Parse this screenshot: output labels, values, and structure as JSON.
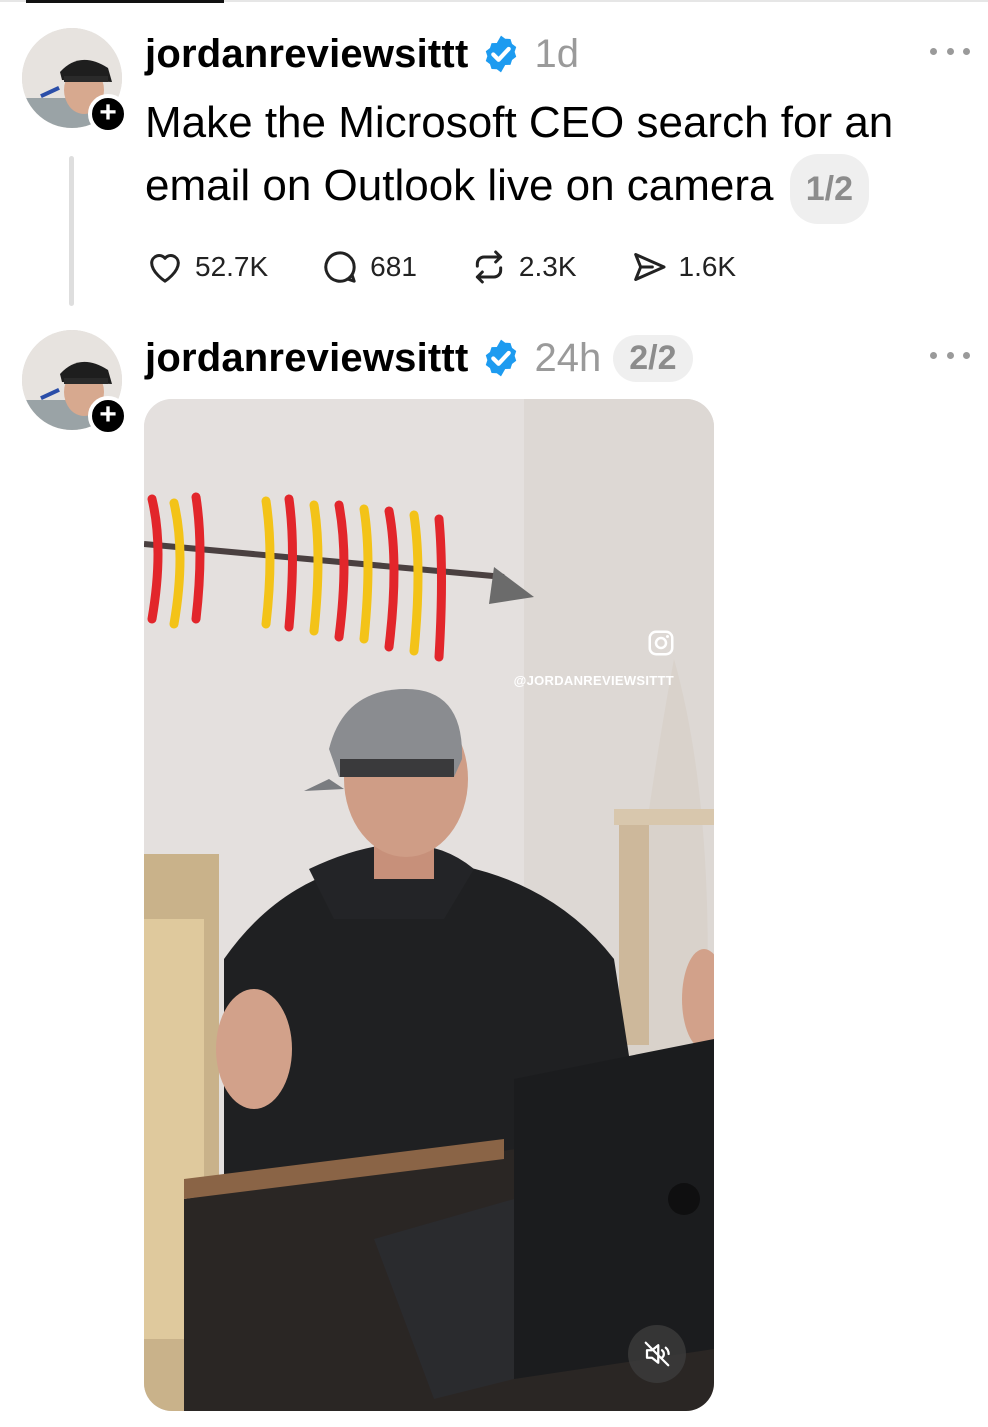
{
  "posts": [
    {
      "username": "jordanreviewsittt",
      "time": "1d",
      "text": "Make the Microsoft CEO search for an email on Outlook live on camera",
      "thread_index": "1/2",
      "actions": {
        "likes": "52.7K",
        "comments": "681",
        "reposts": "2.3K",
        "shares": "1.6K"
      }
    },
    {
      "username": "jordanreviewsittt",
      "time": "24h",
      "thread_index": "2/2",
      "media": {
        "watermark": "@JORDANREVIEWSITTT"
      }
    }
  ],
  "icons": {
    "verified": "verified-badge-icon",
    "more": "more-icon",
    "like": "heart-icon",
    "comment": "comment-icon",
    "repost": "repost-icon",
    "share": "share-icon",
    "mute": "muted-speaker-icon",
    "instagram": "instagram-icon",
    "follow": "plus-icon"
  },
  "colors": {
    "verified": "#1d9bf0",
    "secondary_text": "#9a9a9a",
    "chip_bg": "#efefef"
  }
}
